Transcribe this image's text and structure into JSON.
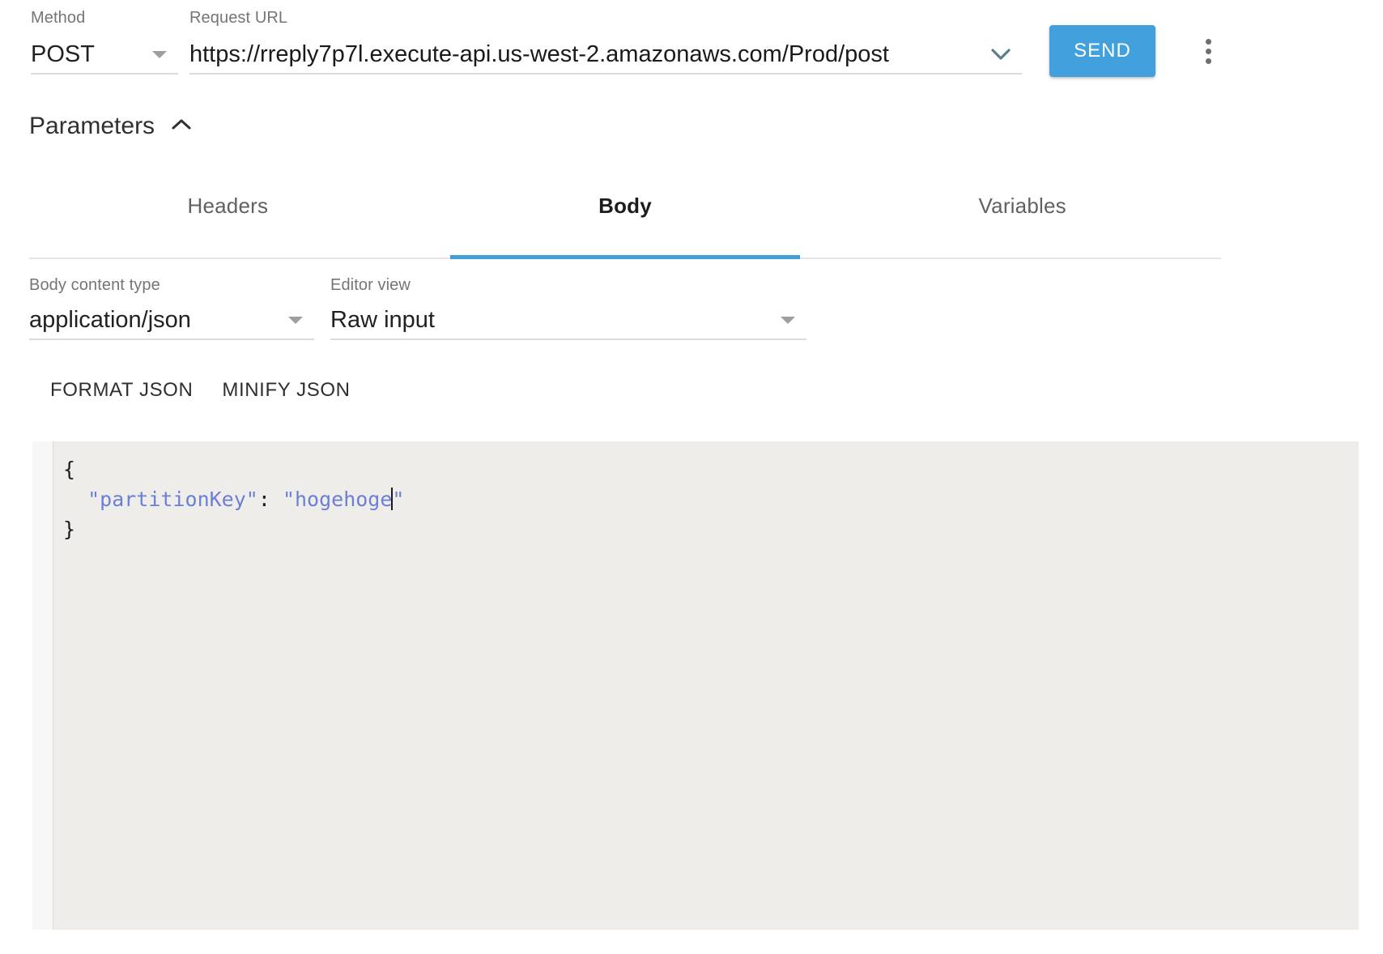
{
  "request": {
    "method_label": "Method",
    "method_value": "POST",
    "url_label": "Request URL",
    "url_value": "https://rreply7p7l.execute-api.us-west-2.amazonaws.com/Prod/post",
    "send_label": "SEND",
    "more_menu_icon": "kebab-menu-icon",
    "method_dropdown_icon": "triangle-down-icon",
    "url_dropdown_icon": "chevron-down-icon"
  },
  "parameters": {
    "title": "Parameters",
    "toggle_icon": "chevron-up-icon",
    "expanded": true,
    "tabs": [
      {
        "label": "Headers",
        "active": false
      },
      {
        "label": "Body",
        "active": true
      },
      {
        "label": "Variables",
        "active": false
      }
    ]
  },
  "body_panel": {
    "content_type": {
      "label": "Body content type",
      "value": "application/json",
      "dropdown_icon": "triangle-down-icon"
    },
    "editor_view": {
      "label": "Editor view",
      "value": "Raw input",
      "dropdown_icon": "triangle-down-icon"
    },
    "actions": [
      {
        "label": "FORMAT JSON"
      },
      {
        "label": "MINIFY JSON"
      }
    ],
    "editor": {
      "line1": "{",
      "line2_indent": "  ",
      "line2_key": "\"partitionKey\"",
      "line2_colon": ": ",
      "line2_value": "\"hogehoge\"",
      "line3": "}",
      "caret_after_value": true
    }
  },
  "colors": {
    "accent": "#42a1dc",
    "tab_indicator": "#3f9fd6",
    "editor_background": "#efedea",
    "gutter_background": "#f7f7f7",
    "string_token": "#6b7fd7",
    "label_text": "#757575",
    "value_text": "#212121"
  }
}
